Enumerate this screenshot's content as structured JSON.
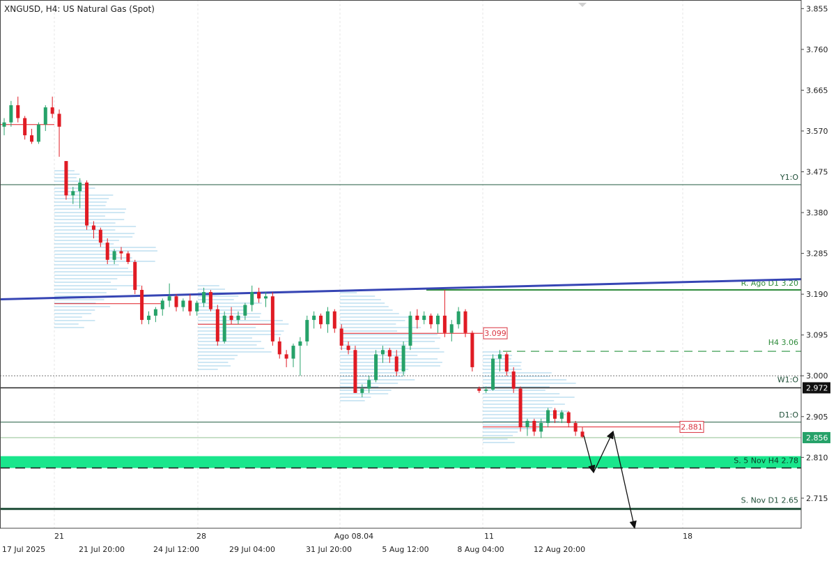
{
  "header": {
    "title": "XNGUSD, H4:  US Natural Gas (Spot)"
  },
  "colors": {
    "bull": "#26a269",
    "bear": "#e01b24",
    "volume_profile": "#9ecfe8",
    "trendline": "#3645b4",
    "resistance": "#2e8b3a",
    "support_zone": "#19e68c",
    "hline": "#1f5a3f",
    "price_label_bg": "#111111",
    "label_red": "#d9333f",
    "grid": "#e6e6e6"
  },
  "chart_data": {
    "type": "candlestick",
    "symbol": "XNGUSD",
    "timeframe": "H4",
    "yticks": [
      "3.855",
      "3.760",
      "3.665",
      "3.570",
      "3.475",
      "3.380",
      "3.285",
      "3.190",
      "3.095",
      "3.000",
      "2.905",
      "2.810",
      "2.715"
    ],
    "ylim": [
      2.645,
      3.875
    ],
    "xlabels_top": [
      "21",
      "28",
      "Ago 08.04",
      "11",
      "18"
    ],
    "xlabels_bottom": [
      "17 Jul 2025",
      "21 Jul 20:00",
      "24 Jul 12:00",
      "29 Jul 04:00",
      "31 Jul 20:00",
      "5 Aug 12:00",
      "8 Aug 04:00",
      "12 Aug 20:00"
    ],
    "candles": [
      [
        3.58,
        3.6,
        3.56,
        3.59
      ],
      [
        3.59,
        3.64,
        3.58,
        3.63
      ],
      [
        3.63,
        3.65,
        3.59,
        3.6
      ],
      [
        3.6,
        3.605,
        3.55,
        3.56
      ],
      [
        3.56,
        3.575,
        3.54,
        3.545
      ],
      [
        3.545,
        3.59,
        3.54,
        3.585
      ],
      [
        3.585,
        3.63,
        3.57,
        3.625
      ],
      [
        3.625,
        3.65,
        3.6,
        3.61
      ],
      [
        3.61,
        3.62,
        3.51,
        3.58
      ],
      [
        3.5,
        3.5,
        3.41,
        3.42
      ],
      [
        3.42,
        3.44,
        3.4,
        3.43
      ],
      [
        3.43,
        3.46,
        3.39,
        3.45
      ],
      [
        3.45,
        3.455,
        3.34,
        3.35
      ],
      [
        3.35,
        3.36,
        3.32,
        3.34
      ],
      [
        3.34,
        3.345,
        3.3,
        3.31
      ],
      [
        3.31,
        3.32,
        3.26,
        3.27
      ],
      [
        3.27,
        3.295,
        3.26,
        3.29
      ],
      [
        3.29,
        3.3,
        3.27,
        3.285
      ],
      [
        3.285,
        3.29,
        3.26,
        3.265
      ],
      [
        3.265,
        3.27,
        3.19,
        3.2
      ],
      [
        3.2,
        3.21,
        3.12,
        3.13
      ],
      [
        3.13,
        3.15,
        3.12,
        3.14
      ],
      [
        3.14,
        3.16,
        3.125,
        3.155
      ],
      [
        3.155,
        3.18,
        3.14,
        3.175
      ],
      [
        3.175,
        3.215,
        3.16,
        3.185
      ],
      [
        3.185,
        3.19,
        3.15,
        3.16
      ],
      [
        3.16,
        3.18,
        3.15,
        3.175
      ],
      [
        3.175,
        3.19,
        3.14,
        3.15
      ],
      [
        3.15,
        3.175,
        3.14,
        3.17
      ],
      [
        3.17,
        3.205,
        3.16,
        3.195
      ],
      [
        3.195,
        3.2,
        3.15,
        3.155
      ],
      [
        3.155,
        3.165,
        3.07,
        3.08
      ],
      [
        3.08,
        3.15,
        3.075,
        3.14
      ],
      [
        3.14,
        3.16,
        3.12,
        3.13
      ],
      [
        3.13,
        3.15,
        3.12,
        3.14
      ],
      [
        3.14,
        3.17,
        3.13,
        3.165
      ],
      [
        3.165,
        3.21,
        3.15,
        3.195
      ],
      [
        3.195,
        3.205,
        3.17,
        3.18
      ],
      [
        3.18,
        3.195,
        3.16,
        3.185
      ],
      [
        3.185,
        3.195,
        3.07,
        3.08
      ],
      [
        3.08,
        3.09,
        3.04,
        3.05
      ],
      [
        3.05,
        3.06,
        3.02,
        3.04
      ],
      [
        3.04,
        3.075,
        3.02,
        3.07
      ],
      [
        3.07,
        3.09,
        3.0,
        3.08
      ],
      [
        3.08,
        3.14,
        3.07,
        3.13
      ],
      [
        3.13,
        3.15,
        3.11,
        3.14
      ],
      [
        3.14,
        3.145,
        3.11,
        3.12
      ],
      [
        3.12,
        3.16,
        3.1,
        3.15
      ],
      [
        3.15,
        3.155,
        3.1,
        3.11
      ],
      [
        3.11,
        3.12,
        3.06,
        3.07
      ],
      [
        3.07,
        3.08,
        3.05,
        3.06
      ],
      [
        3.06,
        3.07,
        2.96,
        2.96
      ],
      [
        2.96,
        2.98,
        2.95,
        2.97
      ],
      [
        2.97,
        3.0,
        2.96,
        2.99
      ],
      [
        2.99,
        3.06,
        2.985,
        3.05
      ],
      [
        3.05,
        3.07,
        3.03,
        3.06
      ],
      [
        3.06,
        3.065,
        3.03,
        3.045
      ],
      [
        3.045,
        3.06,
        3.0,
        3.01
      ],
      [
        3.01,
        3.08,
        3.0,
        3.07
      ],
      [
        3.07,
        3.15,
        3.06,
        3.14
      ],
      [
        3.14,
        3.155,
        3.11,
        3.13
      ],
      [
        3.13,
        3.15,
        3.12,
        3.14
      ],
      [
        3.14,
        3.145,
        3.11,
        3.12
      ],
      [
        3.12,
        3.145,
        3.1,
        3.14
      ],
      [
        3.14,
        3.2,
        3.09,
        3.1
      ],
      [
        3.1,
        3.13,
        3.08,
        3.12
      ],
      [
        3.12,
        3.16,
        3.11,
        3.15
      ],
      [
        3.15,
        3.155,
        3.09,
        3.1
      ],
      [
        3.1,
        3.105,
        3.01,
        3.02
      ],
      [
        2.97,
        2.975,
        2.96,
        2.965
      ],
      [
        2.965,
        2.975,
        2.96,
        2.968
      ],
      [
        2.968,
        3.05,
        2.965,
        3.04
      ],
      [
        3.04,
        3.06,
        3.01,
        3.05
      ],
      [
        3.05,
        3.055,
        3.0,
        3.01
      ],
      [
        3.01,
        3.02,
        2.96,
        2.97
      ],
      [
        2.97,
        2.975,
        2.87,
        2.88
      ],
      [
        2.88,
        2.9,
        2.86,
        2.895
      ],
      [
        2.895,
        2.9,
        2.86,
        2.87
      ],
      [
        2.87,
        2.9,
        2.855,
        2.89
      ],
      [
        2.89,
        2.925,
        2.88,
        2.92
      ],
      [
        2.92,
        2.925,
        2.89,
        2.9
      ],
      [
        2.9,
        2.92,
        2.89,
        2.915
      ],
      [
        2.915,
        2.918,
        2.88,
        2.89
      ],
      [
        2.89,
        2.895,
        2.86,
        2.87
      ],
      [
        2.87,
        2.88,
        2.855,
        2.858
      ]
    ],
    "levels": [
      {
        "name": "Y1:O",
        "value": 3.445,
        "style": "solid-thin"
      },
      {
        "name": "R. Ago D1 3.20",
        "value": 3.2,
        "style": "resistance"
      },
      {
        "name": "H4 3.06",
        "value": 3.057,
        "style": "dashed-green"
      },
      {
        "name": "W1:O",
        "value": 2.972,
        "style": "solid-dark"
      },
      {
        "name": "D1:O",
        "value": 2.892,
        "style": "solid-thin"
      },
      {
        "name": "S. 5 Nov H4 2.78",
        "value": 2.795,
        "style": "zone"
      },
      {
        "name": "S. Nov D1 2.65",
        "value": 2.69,
        "style": "solid-thick"
      }
    ],
    "dotted_level": 3.0,
    "price_labels": [
      {
        "text": "2.972",
        "value": 2.972
      },
      {
        "text": "2.856",
        "value": 2.856
      }
    ],
    "marker_labels": [
      {
        "text": "3.099",
        "value": 3.099
      },
      {
        "text": "2.881",
        "value": 2.881
      }
    ]
  }
}
